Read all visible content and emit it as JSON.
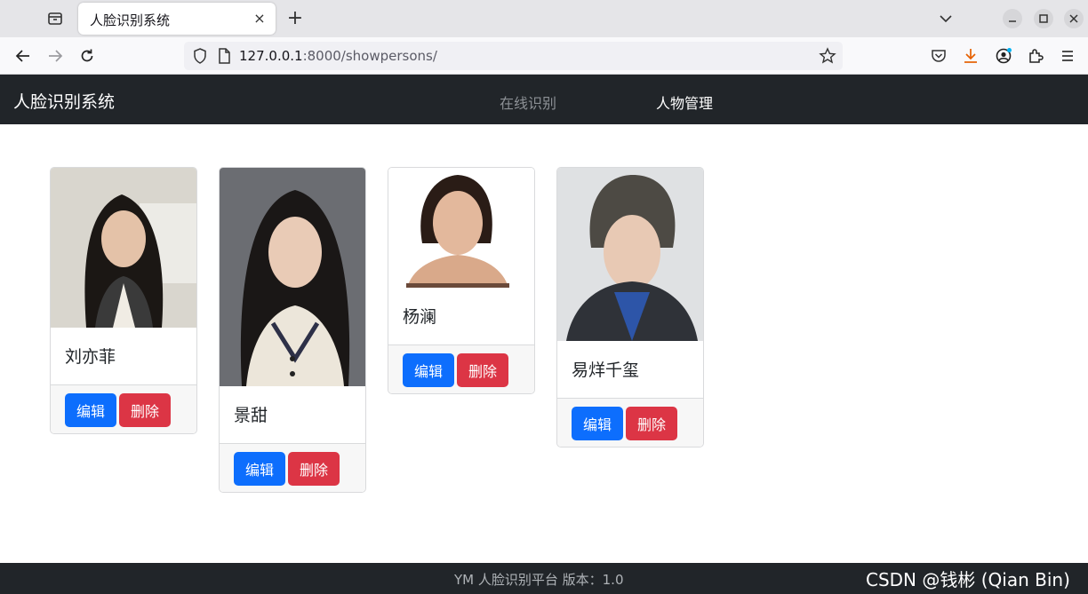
{
  "browser": {
    "tab_title": "人脸识别系统",
    "tab_close": "×",
    "new_tab": "+",
    "url_host": "127.0.0.1",
    "url_rest": ":8000/showpersons/"
  },
  "site": {
    "brand": "人脸识别系统",
    "nav": [
      {
        "label": "在线识别"
      },
      {
        "label": "人物管理"
      }
    ]
  },
  "persons": [
    {
      "name": "刘亦菲",
      "edit_label": "编辑",
      "delete_label": "删除"
    },
    {
      "name": "景甜",
      "edit_label": "编辑",
      "delete_label": "删除"
    },
    {
      "name": "杨澜",
      "edit_label": "编辑",
      "delete_label": "删除"
    },
    {
      "name": "易烊千玺",
      "edit_label": "编辑",
      "delete_label": "删除"
    }
  ],
  "footer": {
    "text": "YM 人脸识别平台   版本：1.0",
    "watermark": "CSDN @钱彬 (Qian Bin)"
  },
  "colors": {
    "nav_bg": "#212529",
    "edit_button": "#0d6efd",
    "delete_button": "#dc3545"
  }
}
